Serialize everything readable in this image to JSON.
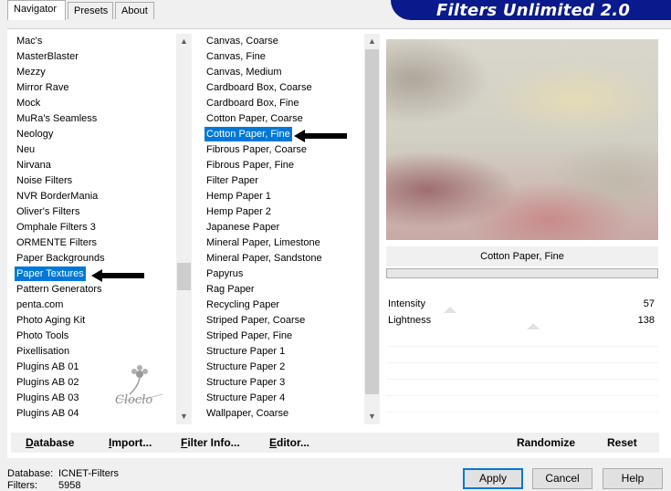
{
  "banner": {
    "title": "Filters Unlimited 2.0"
  },
  "tabs": [
    {
      "label": "Navigator",
      "active": true
    },
    {
      "label": "Presets",
      "active": false
    },
    {
      "label": "About",
      "active": false
    }
  ],
  "categories": {
    "items": [
      "Mac's",
      "MasterBlaster",
      "Mezzy",
      "Mirror Rave",
      "Mock",
      "MuRa's Seamless",
      "Neology",
      "Neu",
      "Nirvana",
      "Noise Filters",
      "NVR BorderMania",
      "Oliver's Filters",
      "Omphale Filters 3",
      "ORMENTE Filters",
      "Paper Backgrounds",
      "Paper Textures",
      "Pattern Generators",
      "penta.com",
      "Photo Aging Kit",
      "Photo Tools",
      "Pixellisation",
      "Plugins AB 01",
      "Plugins AB 02",
      "Plugins AB 03",
      "Plugins AB 04"
    ],
    "selected": "Paper Textures"
  },
  "filters": {
    "items": [
      "Canvas, Coarse",
      "Canvas, Fine",
      "Canvas, Medium",
      "Cardboard Box, Coarse",
      "Cardboard Box, Fine",
      "Cotton Paper, Coarse",
      "Cotton Paper, Fine",
      "Fibrous Paper, Coarse",
      "Fibrous Paper, Fine",
      "Filter Paper",
      "Hemp Paper 1",
      "Hemp Paper 2",
      "Japanese Paper",
      "Mineral Paper, Limestone",
      "Mineral Paper, Sandstone",
      "Papyrus",
      "Rag Paper",
      "Recycling Paper",
      "Striped Paper, Coarse",
      "Striped Paper, Fine",
      "Structure Paper 1",
      "Structure Paper 2",
      "Structure Paper 3",
      "Structure Paper 4",
      "Wallpaper, Coarse"
    ],
    "selected": "Cotton Paper, Fine"
  },
  "preview": {
    "filter_name": "Cotton Paper, Fine",
    "watermark": "Cloclo"
  },
  "parameters": [
    {
      "label": "Intensity",
      "value": "57",
      "level": 57
    },
    {
      "label": "Lightness",
      "value": "138",
      "level": 138
    }
  ],
  "toolbar": {
    "database": {
      "first": "D",
      "rest": "atabase"
    },
    "import": {
      "first": "I",
      "rest": "mport..."
    },
    "filter_info": {
      "first": "F",
      "rest": "ilter Info..."
    },
    "editor": {
      "first": "E",
      "rest": "ditor..."
    },
    "randomize": "Randomize",
    "reset": "Reset"
  },
  "status": {
    "database_label": "Database:",
    "database_value": "ICNET-Filters",
    "filters_label": "Filters:",
    "filters_value": "5958"
  },
  "buttons": {
    "apply": "Apply",
    "cancel": "Cancel",
    "help": "Help"
  },
  "colors": {
    "selection": "#0078d7",
    "banner": "#0a1a8c",
    "default_button_border": "#0078d7"
  }
}
